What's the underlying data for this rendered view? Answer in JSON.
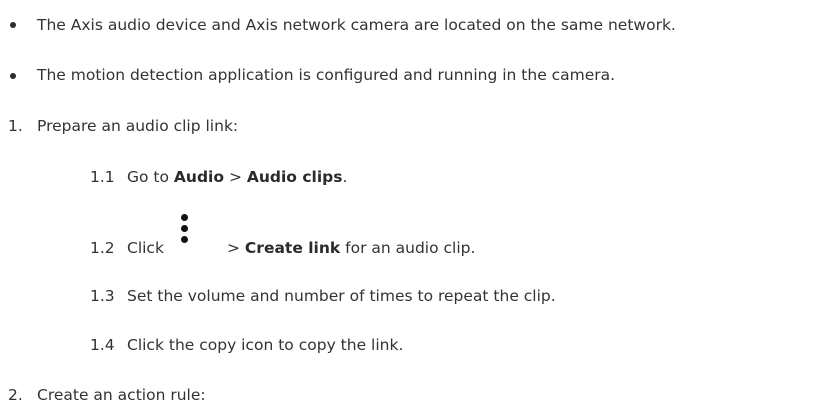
{
  "bullets": [
    "The Axis audio device and Axis network camera are located on the same network.",
    "The motion detection application is configured and running in the camera."
  ],
  "steps": [
    {
      "number": "1.",
      "text": "Prepare an audio clip link:",
      "substeps": [
        {
          "number": "1.1",
          "text_before": "Go to ",
          "bold1": "Audio",
          "separator": " > ",
          "bold2": "Audio clips",
          "text_after": "."
        },
        {
          "number": "1.2",
          "text_before": "Click",
          "icon": "more-vertical-icon",
          "separator": "> ",
          "bold": "Create link",
          "text_after": " for an audio clip."
        },
        {
          "number": "1.3",
          "text": "Set the volume and number of times to repeat the clip."
        },
        {
          "number": "1.4",
          "text": "Click the copy icon to copy the link."
        }
      ]
    },
    {
      "number": "2.",
      "text": "Create an action rule:"
    }
  ]
}
